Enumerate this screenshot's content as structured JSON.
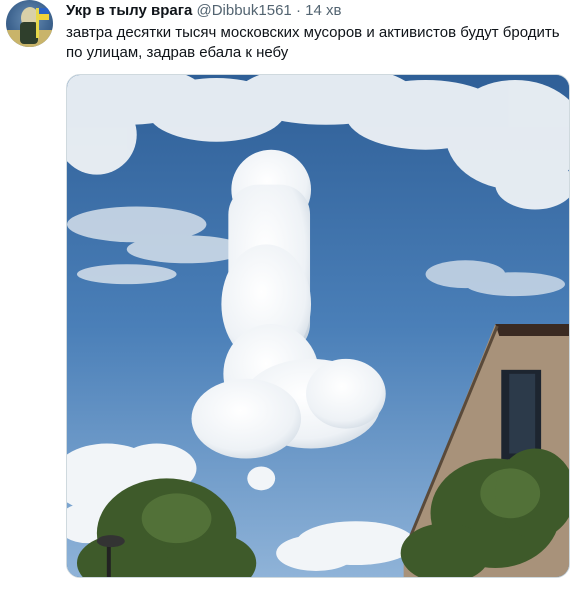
{
  "tweet": {
    "author": {
      "display_name": "Укр в тылу врага",
      "handle": "@Dibbuk1561",
      "separator": "·",
      "time": "14 хв"
    },
    "text": "завтра десятки тысяч московских мусоров и активистов будут бродить по улицам, задрав ебала к небу",
    "media": {
      "icon": "cloud-photo",
      "colors": {
        "sky": "#3b6ea8",
        "cloud": "#f2f5f8",
        "building": "#a8927a",
        "foliage": "#3e5a2a"
      }
    }
  }
}
